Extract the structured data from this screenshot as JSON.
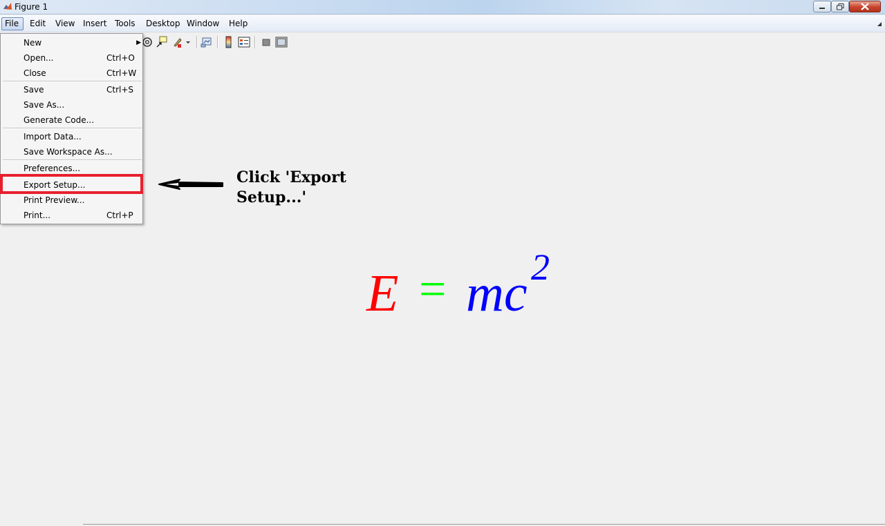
{
  "window": {
    "title": "Figure 1"
  },
  "menubar": {
    "items": [
      {
        "label": "File"
      },
      {
        "label": "Edit"
      },
      {
        "label": "View"
      },
      {
        "label": "Insert"
      },
      {
        "label": "Tools"
      },
      {
        "label": "Desktop"
      },
      {
        "label": "Window"
      },
      {
        "label": "Help"
      }
    ]
  },
  "toolbar": {
    "icons": [
      "rotate-3d-icon",
      "data-cursor-icon",
      "brush-icon",
      "brush-dropdown-icon",
      "link-plot-icon",
      "colorbar-icon",
      "legend-icon",
      "hide-plot-tools-icon",
      "show-plot-tools-icon"
    ]
  },
  "file_menu": {
    "items": [
      {
        "label": "New",
        "shortcut": "",
        "submenu": true
      },
      {
        "label": "Open...",
        "shortcut": "Ctrl+O"
      },
      {
        "label": "Close",
        "shortcut": "Ctrl+W"
      },
      {
        "label": "Save",
        "shortcut": "Ctrl+S"
      },
      {
        "label": "Save As...",
        "shortcut": ""
      },
      {
        "label": "Generate Code...",
        "shortcut": ""
      },
      {
        "label": "Import Data...",
        "shortcut": ""
      },
      {
        "label": "Save Workspace As...",
        "shortcut": ""
      },
      {
        "label": "Preferences...",
        "shortcut": ""
      },
      {
        "label": "Export Setup...",
        "shortcut": "",
        "highlighted": true
      },
      {
        "label": "Print Preview...",
        "shortcut": ""
      },
      {
        "label": "Print...",
        "shortcut": "Ctrl+P"
      }
    ],
    "highlight_color": "#e8202e"
  },
  "annotation": {
    "line1": "Click 'Export",
    "line2": "Setup...'"
  },
  "equation": {
    "E": "E",
    "equals": "=",
    "mc": "mc",
    "power": "2",
    "colors": {
      "E": "#ff0000",
      "equals": "#00ff00",
      "mc": "#0000ff"
    }
  }
}
